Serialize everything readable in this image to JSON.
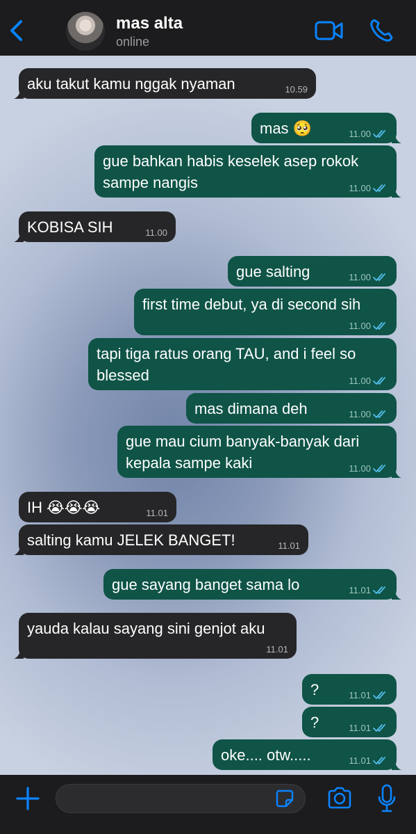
{
  "header": {
    "contact_name": "mas alta",
    "status": "online"
  },
  "messages": [
    {
      "dir": "in",
      "text": "aku takut kamu nggak nyaman",
      "time": "10.59"
    },
    {
      "dir": "out",
      "text": "mas 🥺",
      "time": "11.00"
    },
    {
      "dir": "out",
      "text": "gue bahkan habis keselek asep rokok\nsampe nangis",
      "time": "11.00"
    },
    {
      "dir": "in",
      "text": "KOBISA SIH",
      "time": "11.00"
    },
    {
      "dir": "out",
      "text": "gue salting",
      "time": "11.00"
    },
    {
      "dir": "out",
      "text": "first time debut, ya di second sih",
      "time": "11.00"
    },
    {
      "dir": "out",
      "text": "tapi tiga ratus orang TAU, and i feel so\nblessed",
      "time": "11.00"
    },
    {
      "dir": "out",
      "text": "mas dimana deh",
      "time": "11.00"
    },
    {
      "dir": "out",
      "text": "gue mau cium banyak-banyak dari\nkepala sampe kaki",
      "time": "11.00"
    },
    {
      "dir": "in",
      "text": "IH 😭😭😭",
      "time": "11.01"
    },
    {
      "dir": "in",
      "text": "salting kamu JELEK BANGET!",
      "time": "11.01"
    },
    {
      "dir": "out",
      "text": "gue sayang banget sama lo",
      "time": "11.01"
    },
    {
      "dir": "in",
      "text": "yauda kalau sayang sini genjot aku",
      "time": "11.01"
    },
    {
      "dir": "out",
      "text": "?",
      "time": "11.01"
    },
    {
      "dir": "out",
      "text": "?",
      "time": "11.01"
    },
    {
      "dir": "out",
      "text": "oke.... otw.....",
      "time": "11.01"
    }
  ],
  "footer": {
    "input_value": "",
    "input_placeholder": ""
  },
  "colors": {
    "accent": "#0a84ff",
    "bubble_out": "#0f5447",
    "bubble_in": "#262628",
    "read_ticks": "#53bdeb"
  }
}
